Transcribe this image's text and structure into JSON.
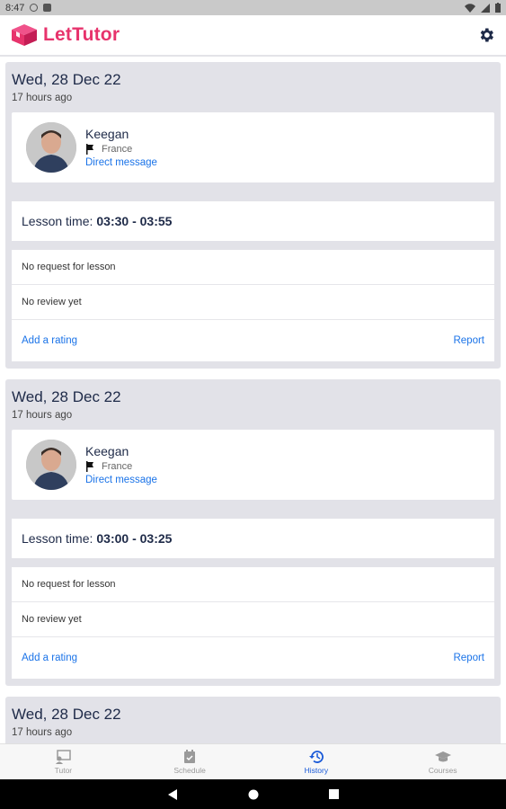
{
  "status_bar": {
    "time": "8:47"
  },
  "app": {
    "name": "LetTutor",
    "brand_color": "#e7336c",
    "link_color": "#1a73e8"
  },
  "sessions": [
    {
      "date": "Wed, 28 Dec 22",
      "ago": "17 hours ago",
      "tutor": {
        "name": "Keegan",
        "country": "France",
        "dm_label": "Direct message"
      },
      "lesson_label": "Lesson time:",
      "lesson_time": "03:30 - 03:55",
      "request_text": "No request for lesson",
      "review_text": "No review yet",
      "rating_label": "Add a rating",
      "report_label": "Report"
    },
    {
      "date": "Wed, 28 Dec 22",
      "ago": "17 hours ago",
      "tutor": {
        "name": "Keegan",
        "country": "France",
        "dm_label": "Direct message"
      },
      "lesson_label": "Lesson time:",
      "lesson_time": "03:00 - 03:25",
      "request_text": "No request for lesson",
      "review_text": "No review yet",
      "rating_label": "Add a rating",
      "report_label": "Report"
    },
    {
      "date": "Wed, 28 Dec 22",
      "ago": "17 hours ago"
    }
  ],
  "bottom_nav": {
    "items": [
      {
        "label": "Tutor",
        "icon": "tutor-icon",
        "active": false
      },
      {
        "label": "Schedule",
        "icon": "calendar-icon",
        "active": false
      },
      {
        "label": "History",
        "icon": "history-icon",
        "active": true
      },
      {
        "label": "Courses",
        "icon": "graduation-cap-icon",
        "active": false
      }
    ]
  }
}
